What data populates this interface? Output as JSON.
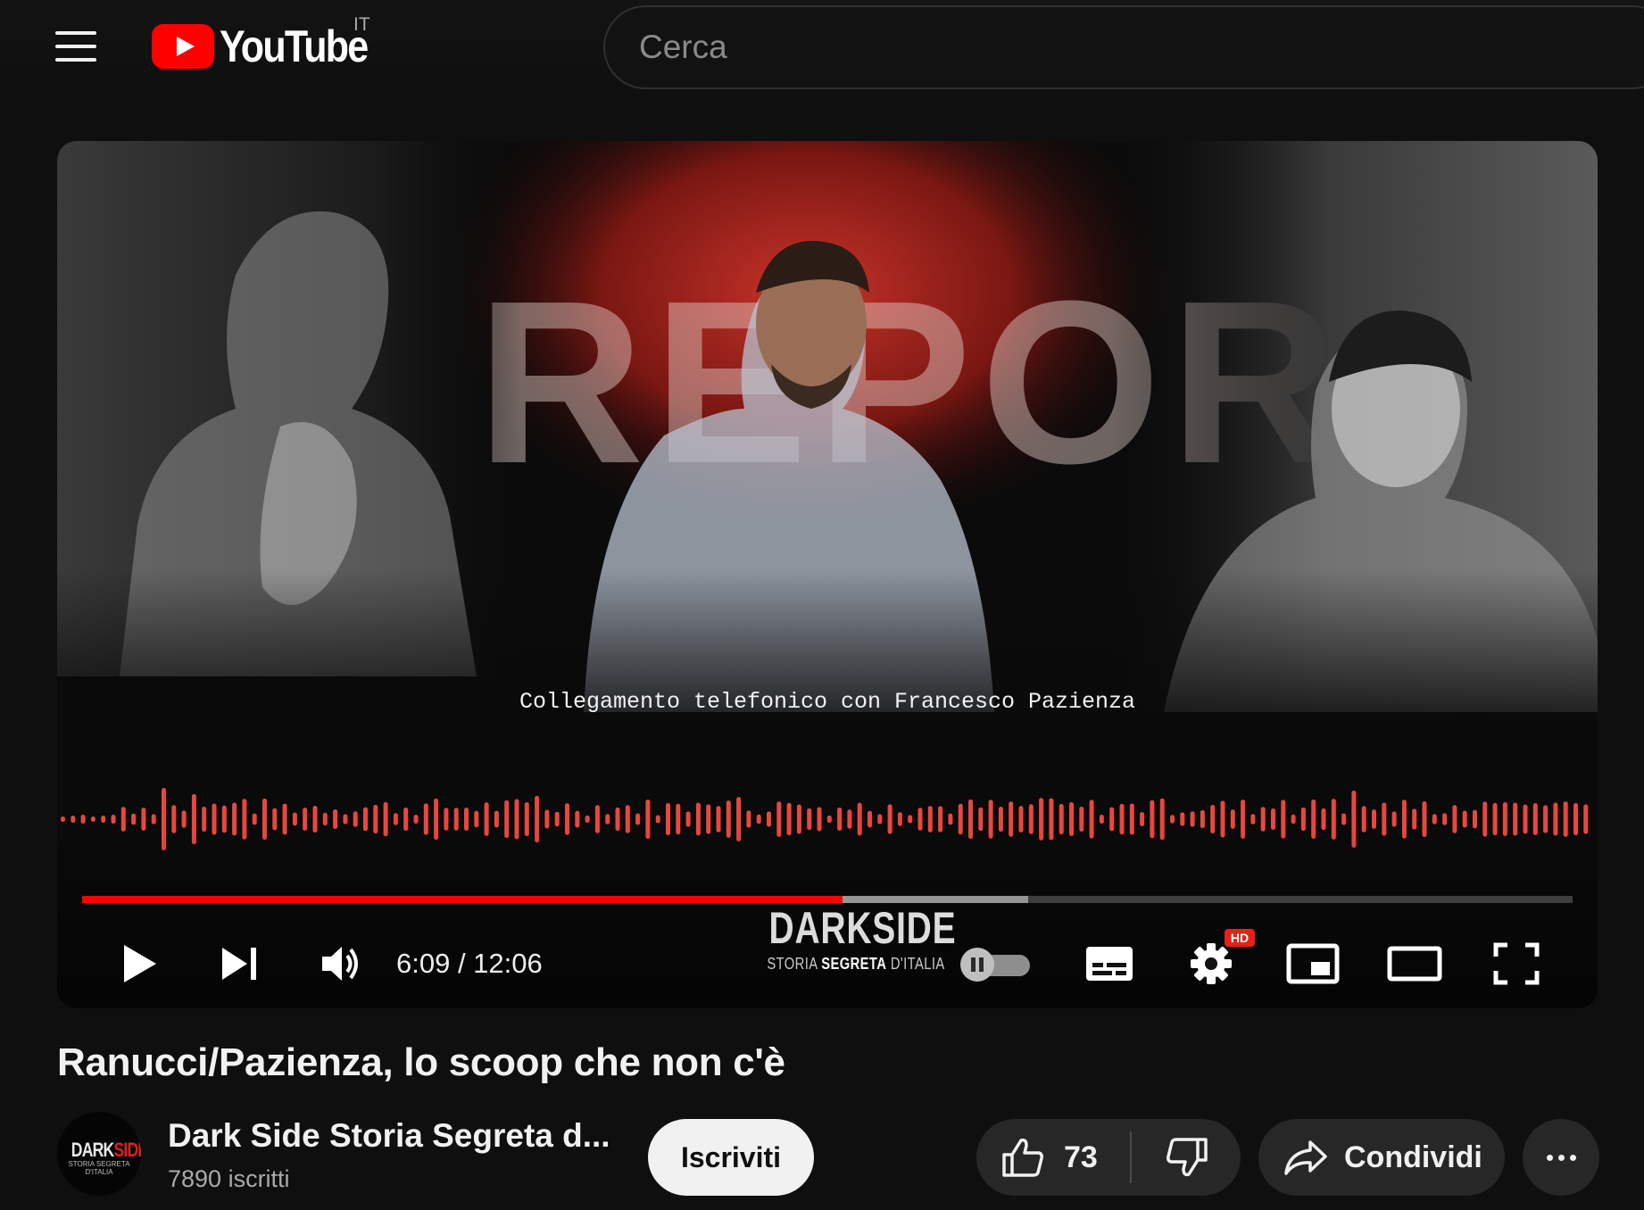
{
  "header": {
    "logo_text": "YouTube",
    "country_code": "IT",
    "search_placeholder": "Cerca"
  },
  "player": {
    "caption": "Collegamento telefonico con Francesco Pazienza",
    "backdrop_letters": "REPOR",
    "current_time": "6:09",
    "duration": "12:06",
    "time_display": "6:09 / 12:06",
    "progress_fraction": 0.51,
    "buffered_fraction": 0.635,
    "watermark_title": "DARKSIDE",
    "watermark_subtitle_1": "STORIA",
    "watermark_subtitle_2": "SEGRETA",
    "watermark_subtitle_3": "D'ITALIA",
    "hd_badge": "HD",
    "autoplay_on": false,
    "accent_color": "#ff0000",
    "waveform_color": "#e8473f"
  },
  "video": {
    "title": "Ranucci/Pazienza, lo scoop che non c'è"
  },
  "channel": {
    "name": "Dark Side Storia Segreta d...",
    "subscribers": "7890 iscritti",
    "avatar_text_1": "DARK",
    "avatar_text_2": "SIDE",
    "avatar_sub": "STORIA SEGRETA D'ITALIA",
    "subscribe_label": "Iscriviti"
  },
  "actions": {
    "like_count": "73",
    "share_label": "Condividi"
  },
  "icons": {
    "menu": "hamburger-icon",
    "play": "play-icon",
    "next": "skip-next-icon",
    "volume": "volume-icon",
    "subtitles": "subtitles-icon",
    "settings": "gear-icon",
    "miniplayer": "miniplayer-icon",
    "theater": "theater-icon",
    "fullscreen": "fullscreen-icon",
    "like": "thumbs-up-icon",
    "dislike": "thumbs-down-icon",
    "share": "share-arrow-icon",
    "more": "more-dots-icon"
  }
}
